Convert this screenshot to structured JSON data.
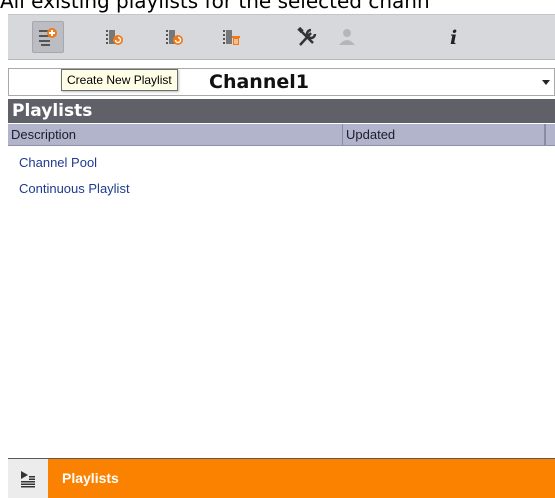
{
  "header_caption": "All existing playlists for the selected chann",
  "toolbar": {
    "buttons": [
      {
        "name": "create-playlist",
        "icon": "playlist-add-icon"
      },
      {
        "name": "playlist-refresh",
        "icon": "playlist-refresh-icon"
      },
      {
        "name": "playlist-refresh-2",
        "icon": "playlist-refresh-icon"
      },
      {
        "name": "delete-playlist",
        "icon": "playlist-delete-icon"
      },
      {
        "name": "tools",
        "icon": "tools-icon"
      },
      {
        "name": "user",
        "icon": "user-icon"
      },
      {
        "name": "info",
        "icon": "info-icon"
      }
    ],
    "tooltip": "Create New Playlist"
  },
  "channel": {
    "selected": "Channel1"
  },
  "panel": {
    "title": "Playlists",
    "columns": [
      "Description",
      "Updated"
    ],
    "rows": [
      {
        "description": "Channel Pool",
        "updated": ""
      },
      {
        "description": "Continuous Playlist",
        "updated": ""
      }
    ]
  },
  "footer": {
    "label": "Playlists",
    "icon": "playlists-icon",
    "accent": "#fa8200"
  }
}
